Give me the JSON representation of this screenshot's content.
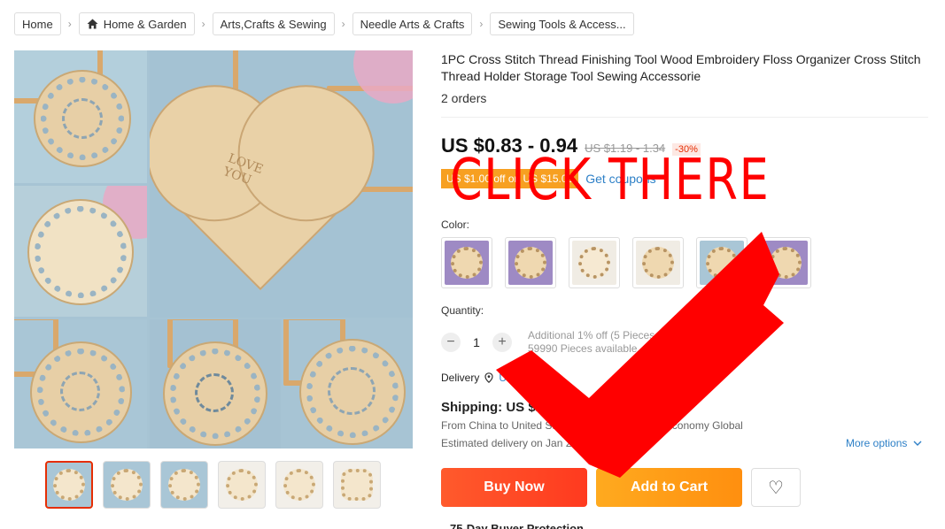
{
  "breadcrumb": {
    "items": [
      {
        "label": "Home",
        "icon": ""
      },
      {
        "label": "Home & Garden",
        "icon": "house-icon"
      },
      {
        "label": "Arts,Crafts & Sewing",
        "icon": ""
      },
      {
        "label": "Needle Arts & Crafts",
        "icon": ""
      },
      {
        "label": "Sewing Tools & Access...",
        "icon": ""
      }
    ],
    "separator": "›"
  },
  "gallery": {
    "heart_text": "LOVE\nYOU"
  },
  "product": {
    "title": "1PC Cross Stitch Thread Finishing Tool Wood Embroidery Floss Organizer Cross Stitch Thread Holder Storage Tool Sewing Accessorie",
    "orders": "2 orders",
    "price": "US $0.83 - 0.94",
    "old_price": "US $1.19 - 1.34",
    "discount": "-30%",
    "coupon_tag": "US $1.00 off on US $15.00",
    "coupon_link": "Get coupons",
    "color_label": "Color:",
    "quantity_label": "Quantity:",
    "quantity_value": "1",
    "quantity_minus": "−",
    "quantity_plus": "+",
    "quantity_info_line1": "Additional 1% off (5 Pieces or more)",
    "quantity_info_line2": "59990 Pieces available",
    "delivery_label": "Delivery",
    "delivery_location": "United States",
    "shipping": "Shipping: US $1.47",
    "ship_from_line": "From China to United States via Cainiao Super Economy Global",
    "ship_estimate": "Estimated delivery on Jan 29",
    "more_options": "More options",
    "buy_now": "Buy Now",
    "add_to_cart": "Add to Cart",
    "wishlist": "♡",
    "protection": "75-Day Buyer Protection"
  },
  "overlay": {
    "text": "CLICK  THERE",
    "color": "#ff0000"
  },
  "colors": {
    "accent_red": "#e62e04",
    "buy_button": "#ff4a25",
    "cart_button": "#ff9e18",
    "link_blue": "#2e80c7"
  }
}
